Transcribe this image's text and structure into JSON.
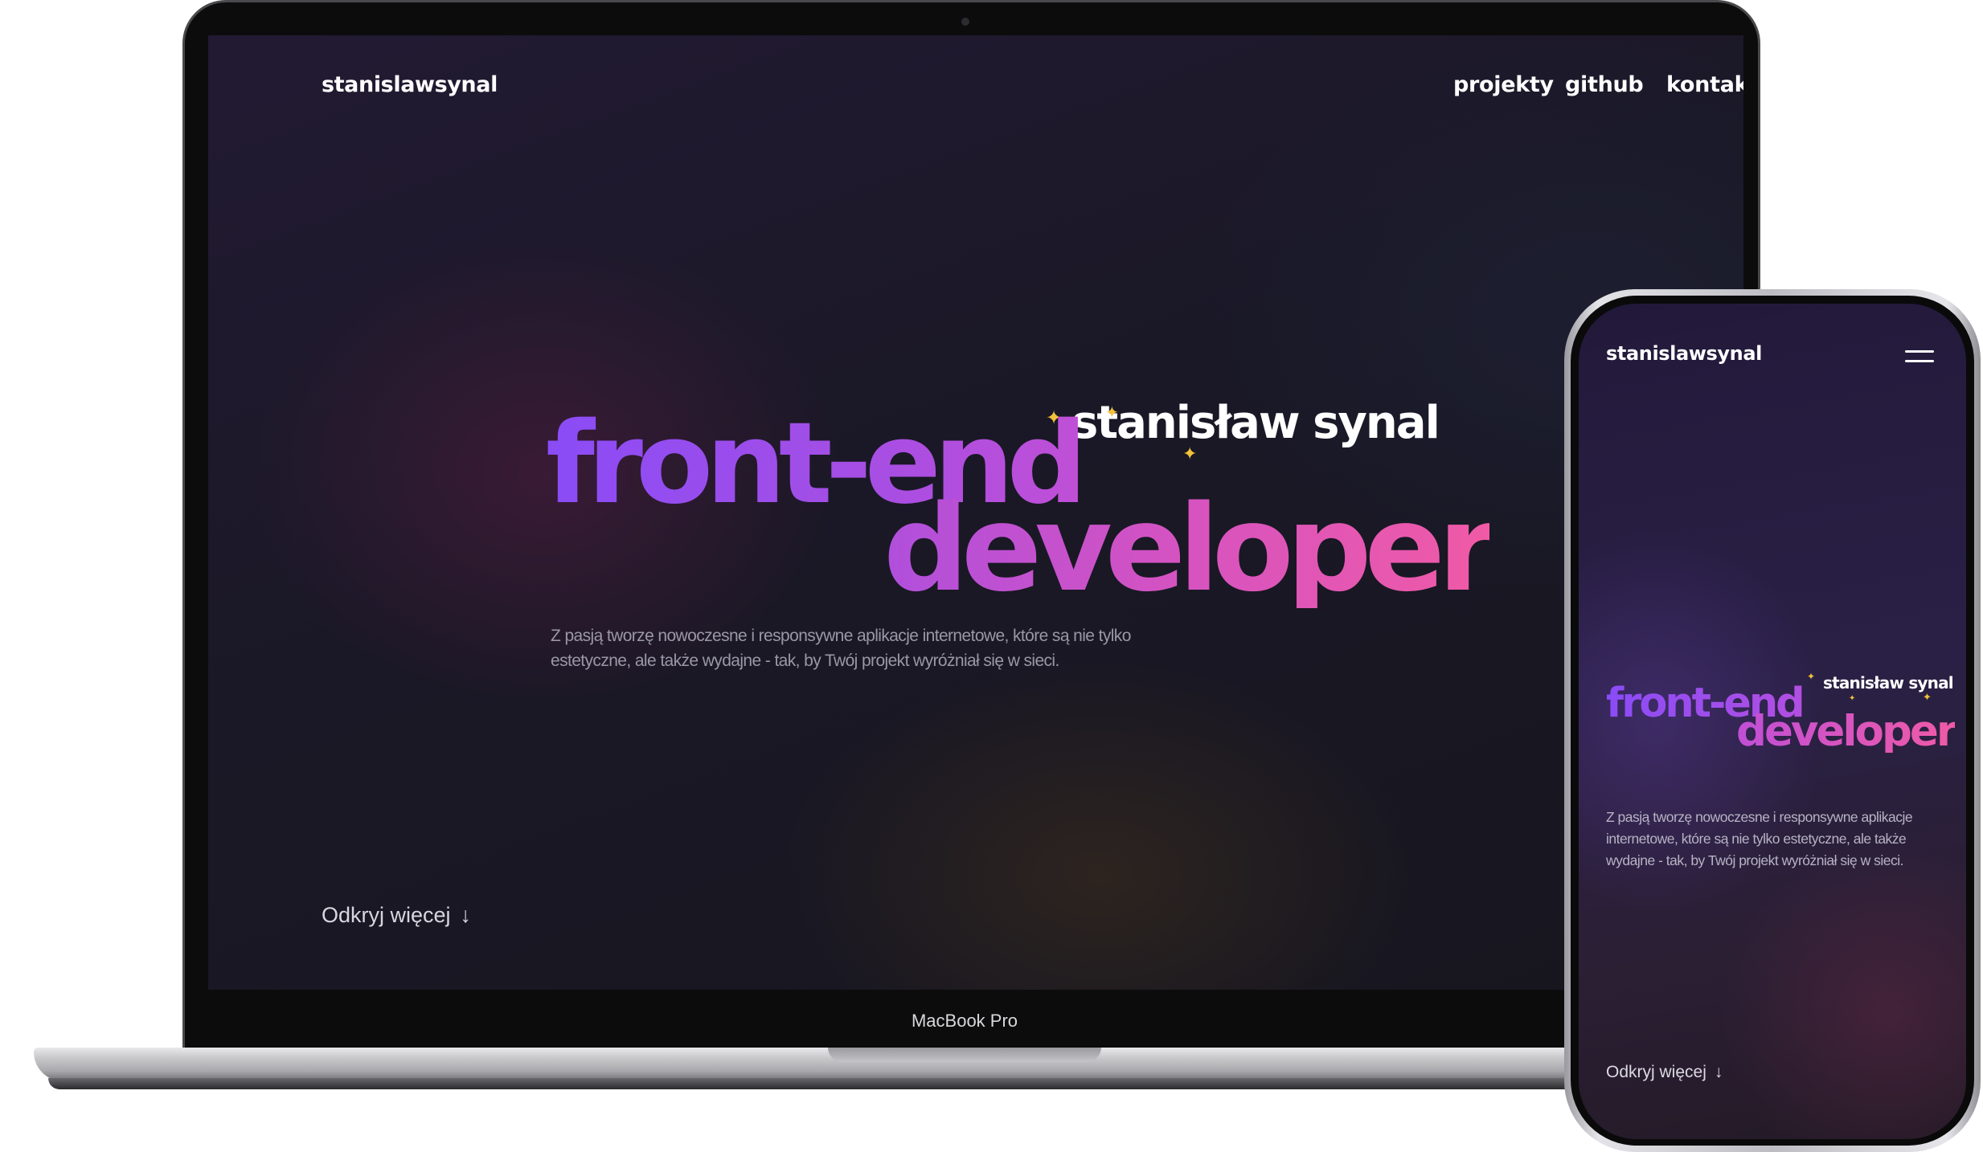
{
  "laptop": {
    "header": {
      "logo": "stanislawsynal",
      "nav": [
        "projekty",
        "github",
        "kontakt"
      ]
    },
    "hero": {
      "name": "stanisław synal",
      "title_line1": "front-end",
      "title_line2": "developer",
      "description": "Z pasją tworzę nowoczesne i responsywne aplikacje internetowe, które są nie tylko estetyczne, ale także wydajne - tak, by Twój projekt wyróżniał się w sieci."
    },
    "cta": {
      "label": "Odkryj więcej",
      "arrow": "↓"
    },
    "bezel_label": "MacBook Pro"
  },
  "phone": {
    "header": {
      "logo": "stanislawsynal",
      "menu_icon": "hamburger-menu-icon"
    },
    "hero": {
      "name": "stanisław synal",
      "title_line1": "front-end",
      "title_line2": "developer",
      "description": "Z pasją tworzę nowoczesne i responsywne aplikacje internetowe, które są nie tylko estetyczne, ale także wydajne - tak, by Twój projekt wyróżniał się w sieci."
    },
    "cta": {
      "label": "Odkryj więcej",
      "arrow": "↓"
    }
  },
  "colors": {
    "gradient_purple": "#8a4cf6",
    "gradient_magenta": "#c04fd6",
    "gradient_pink": "#f05aa6",
    "star_yellow": "#f2c23a",
    "background_dark": "#1a1826"
  }
}
